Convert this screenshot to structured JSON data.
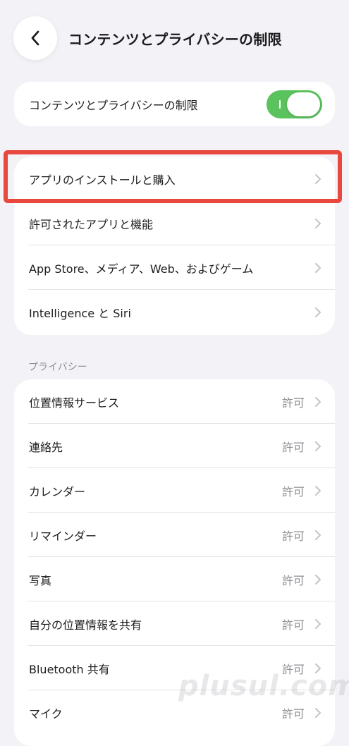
{
  "header": {
    "back_icon": "chevron-left-icon",
    "title": "コンテンツとプライバシーの制限"
  },
  "main_toggle": {
    "label": "コンテンツとプライバシーの制限",
    "state": "on",
    "accent_color": "#5ac35e"
  },
  "menu": {
    "items": [
      {
        "label": "アプリのインストールと購入",
        "highlighted": true
      },
      {
        "label": "許可されたアプリと機能"
      },
      {
        "label": "App Store、メディア、Web、およびゲーム"
      },
      {
        "label": "Intelligence と Siri"
      }
    ]
  },
  "privacy": {
    "header": "プライバシー",
    "items": [
      {
        "label": "位置情報サービス",
        "value": "許可"
      },
      {
        "label": "連絡先",
        "value": "許可"
      },
      {
        "label": "カレンダー",
        "value": "許可"
      },
      {
        "label": "リマインダー",
        "value": "許可"
      },
      {
        "label": "写真",
        "value": "許可"
      },
      {
        "label": "自分の位置情報を共有",
        "value": "許可"
      },
      {
        "label": "Bluetooth 共有",
        "value": "許可"
      },
      {
        "label": "マイク",
        "value": "許可"
      }
    ]
  },
  "highlight_color": "#e8483d",
  "watermark": "plusul.com"
}
